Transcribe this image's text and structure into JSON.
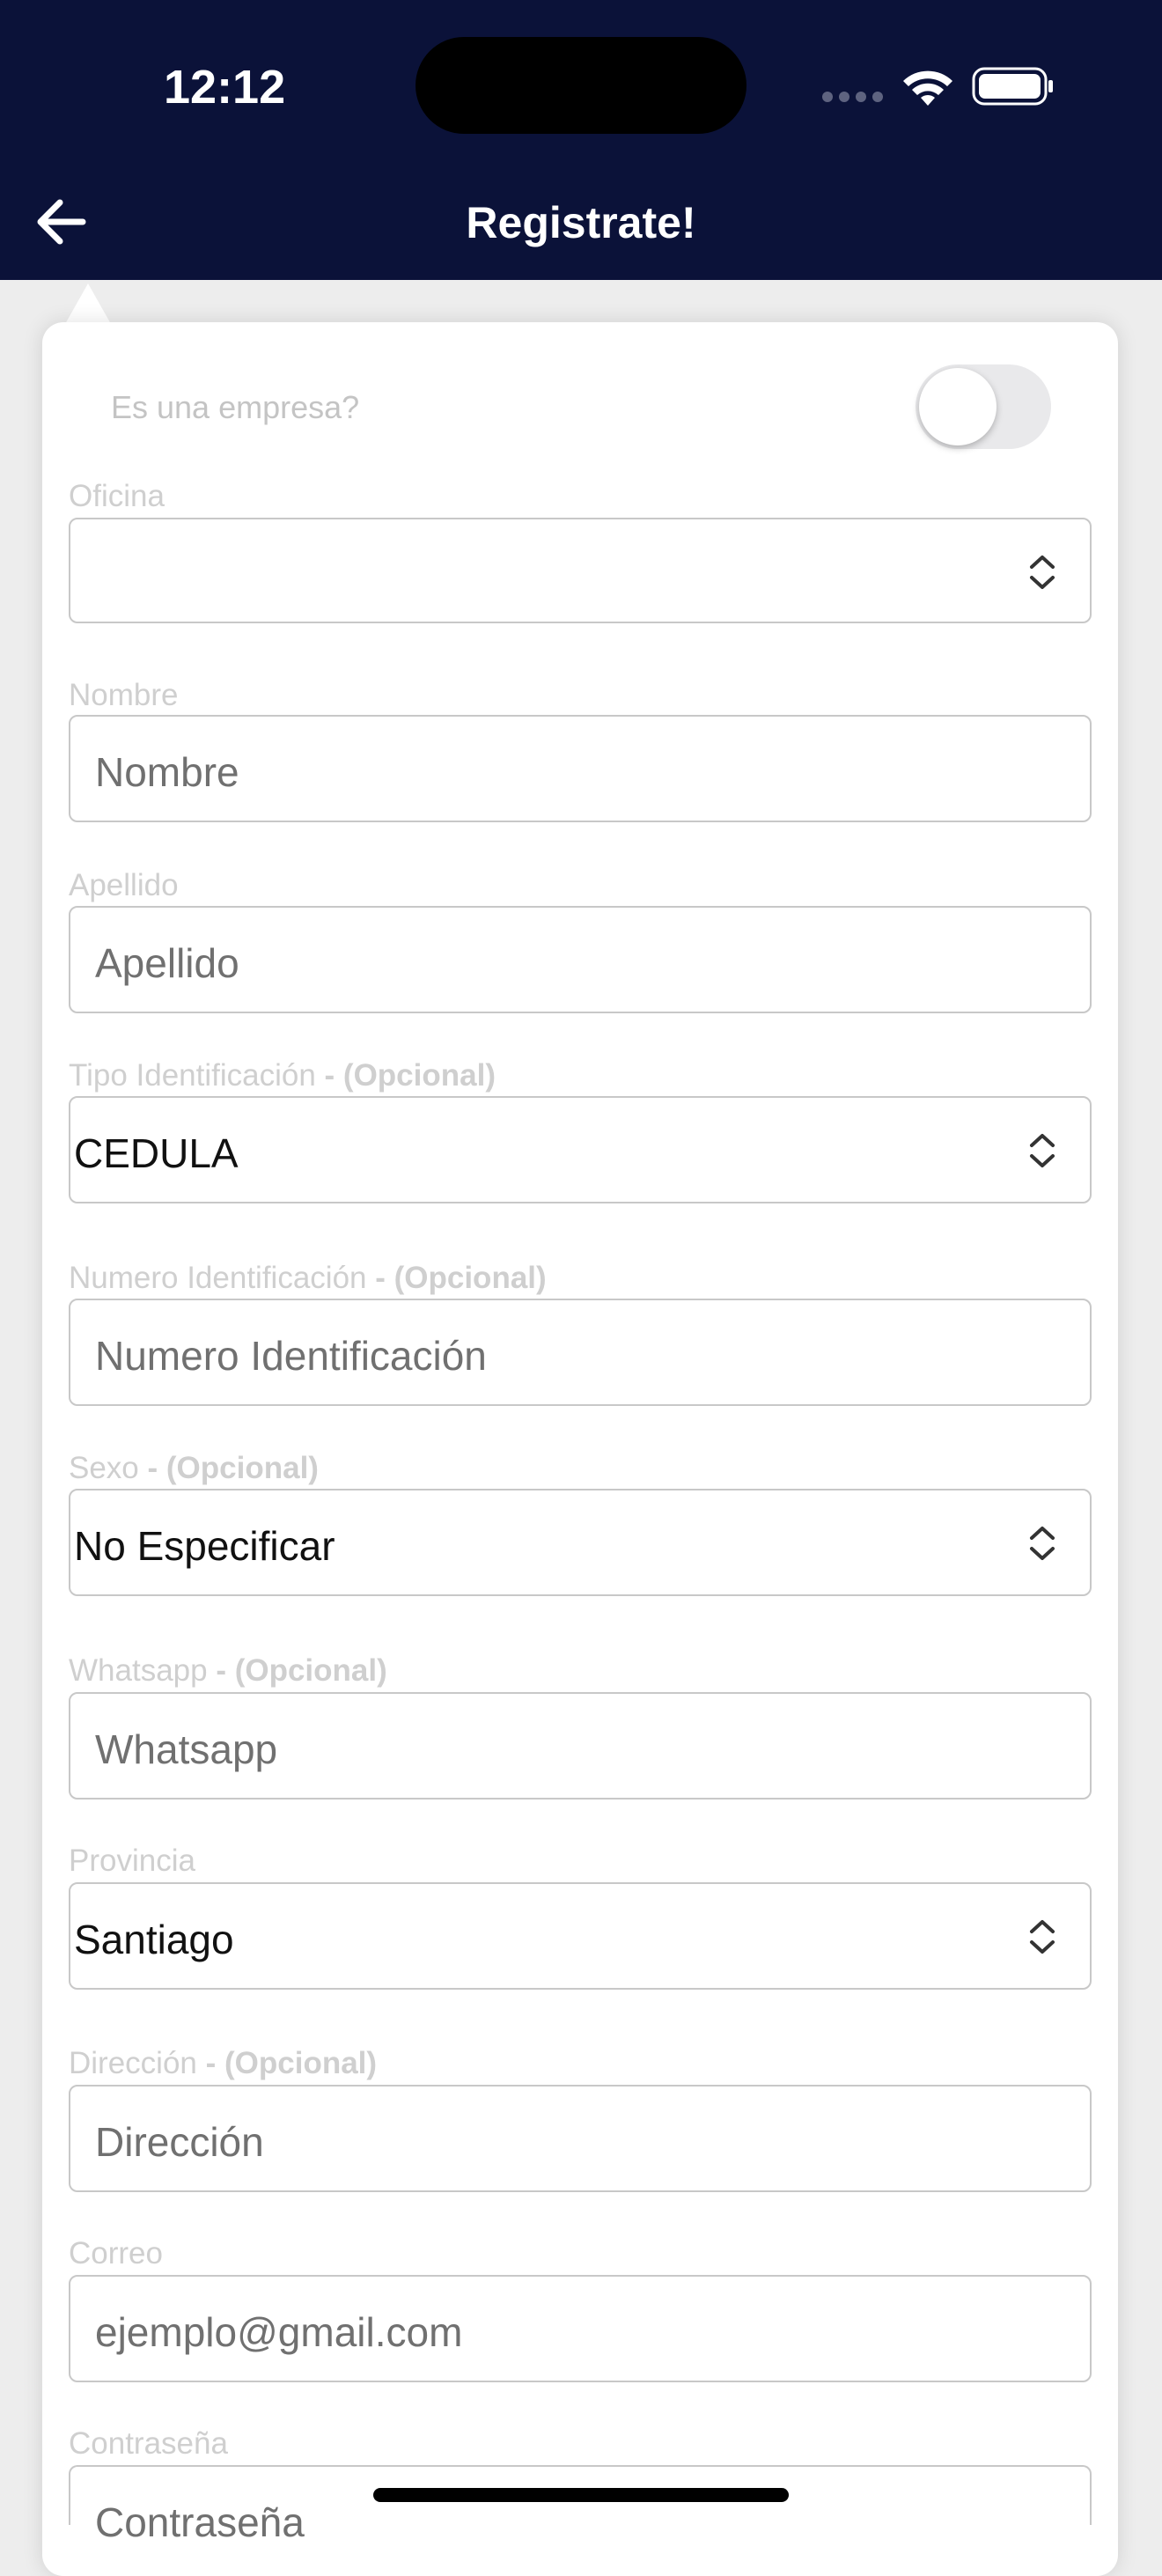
{
  "status_bar": {
    "time": "12:12",
    "icons": [
      "cellular-signal-icon",
      "wifi-icon",
      "battery-icon"
    ]
  },
  "header": {
    "title": "Registrate!",
    "back_icon": "arrow-left-icon"
  },
  "colors": {
    "header_bg": "#0b1239",
    "page_bg": "#ededed",
    "card_bg": "#ffffff",
    "label_text": "#cfcfcf",
    "placeholder_text": "#707070"
  },
  "form": {
    "company_toggle": {
      "label": "Es una empresa?",
      "checked": false
    },
    "oficina": {
      "label": "Oficina",
      "value": ""
    },
    "nombre": {
      "label": "Nombre",
      "placeholder": "Nombre"
    },
    "apellido": {
      "label": "Apellido",
      "placeholder": "Apellido"
    },
    "tipo_identificacion": {
      "label": "Tipo Identificación",
      "optional": "- (Opcional)",
      "value": "CEDULA"
    },
    "numero_identificacion": {
      "label": "Numero Identificación",
      "optional": "- (Opcional)",
      "placeholder": "Numero Identificación"
    },
    "sexo": {
      "label": "Sexo",
      "optional": "- (Opcional)",
      "value": "No Especificar"
    },
    "whatsapp": {
      "label": "Whatsapp",
      "optional": "- (Opcional)",
      "placeholder": "Whatsapp"
    },
    "provincia": {
      "label": "Provincia",
      "value": "Santiago"
    },
    "direccion": {
      "label": "Dirección",
      "optional": "- (Opcional)",
      "placeholder": "Dirección"
    },
    "correo": {
      "label": "Correo",
      "placeholder": "ejemplo@gmail.com"
    },
    "contrasena": {
      "label": "Contraseña",
      "placeholder": "Contraseña"
    }
  }
}
